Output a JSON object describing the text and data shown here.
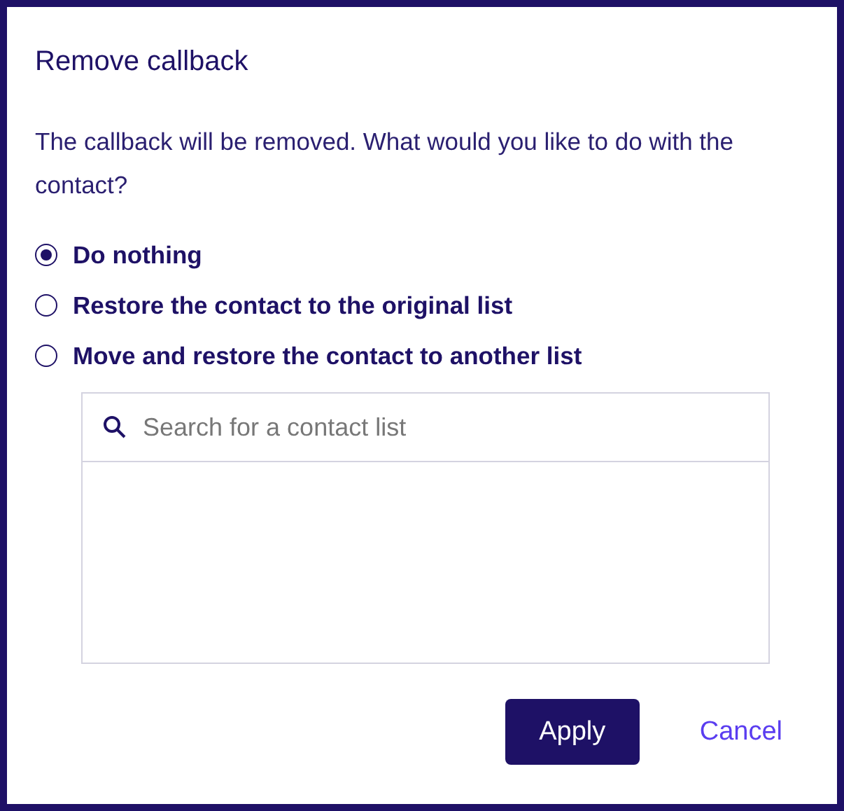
{
  "dialog": {
    "title": "Remove callback",
    "message": "The callback will be removed. What would you like to do with the contact?"
  },
  "options": [
    {
      "label": "Do nothing",
      "selected": true
    },
    {
      "label": "Restore the contact to the original list",
      "selected": false
    },
    {
      "label": "Move and restore the contact to another list",
      "selected": false
    }
  ],
  "search": {
    "placeholder": "Search for a contact list"
  },
  "buttons": [
    {
      "label": "Apply",
      "kind": "primary"
    },
    {
      "label": "Cancel",
      "kind": "link"
    }
  ]
}
